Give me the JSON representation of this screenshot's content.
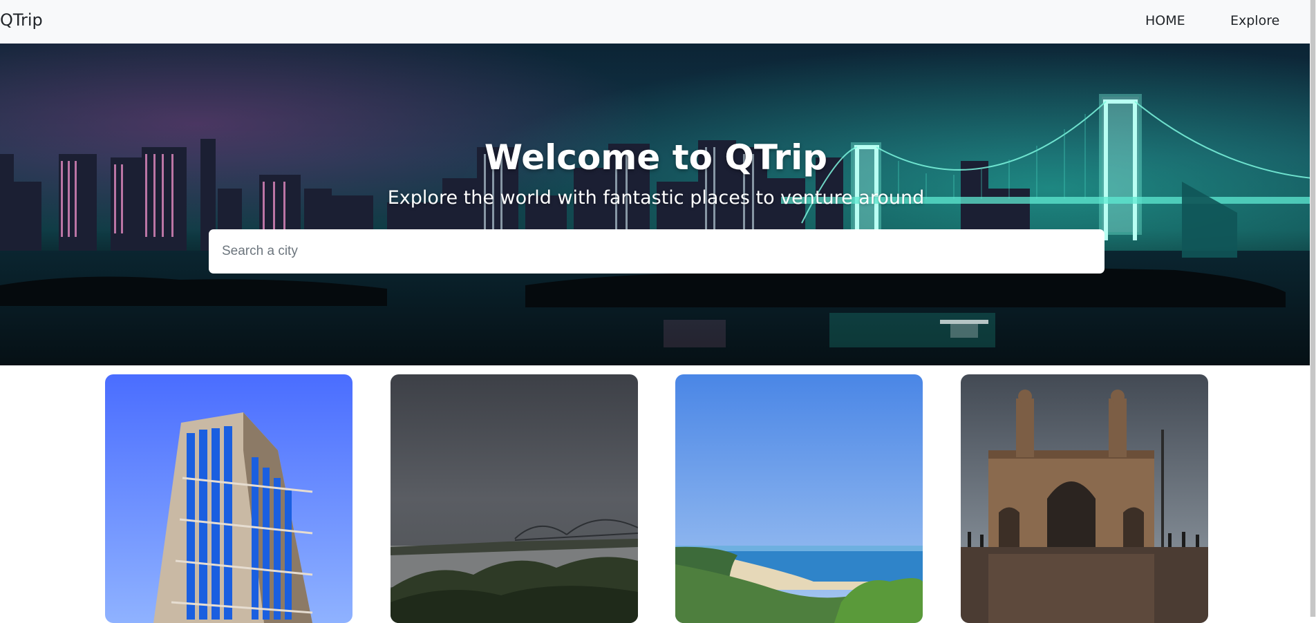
{
  "nav": {
    "brand": "QTrip",
    "links": [
      {
        "label": "HOME"
      },
      {
        "label": "Explore"
      }
    ]
  },
  "hero": {
    "title": "Welcome to QTrip",
    "subtitle": "Explore the world with fantastic places to venture around",
    "search_placeholder": "Search a city"
  },
  "cities": [
    {
      "image": "office-tower-photo"
    },
    {
      "image": "river-bridge-photo"
    },
    {
      "image": "beach-coast-photo"
    },
    {
      "image": "gateway-monument-photo"
    }
  ],
  "colors": {
    "navbar_bg": "#f8f9fa",
    "hero_accent": "#2ee6c8",
    "text_dark": "#212529"
  }
}
